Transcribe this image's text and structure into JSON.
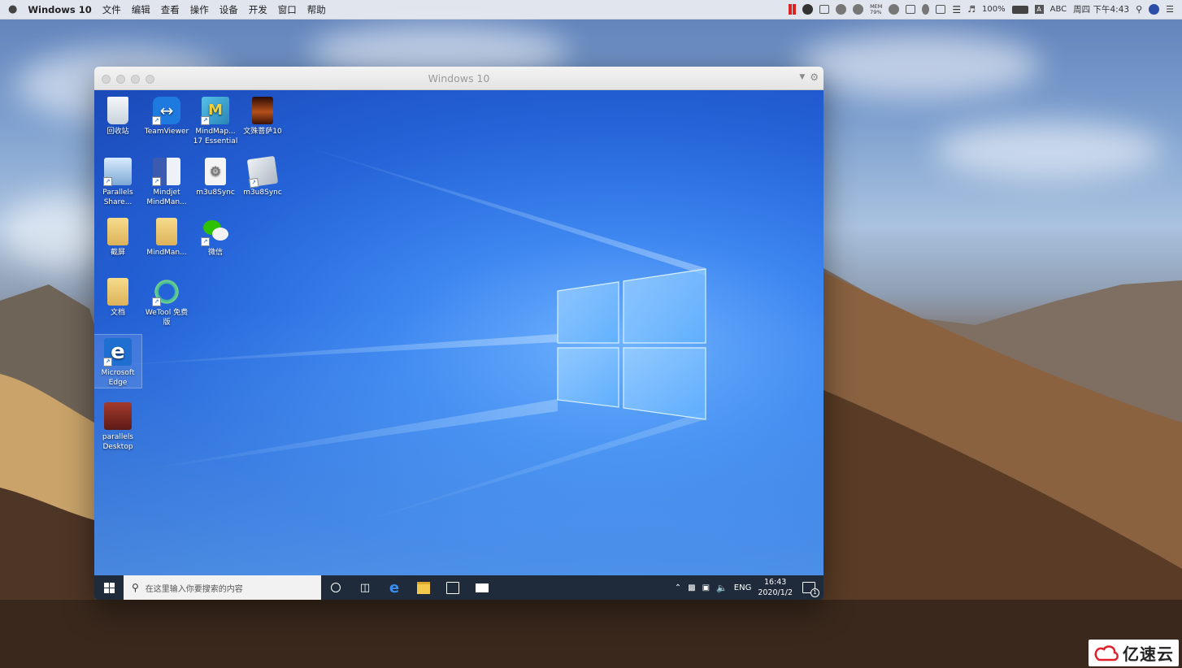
{
  "menubar": {
    "apple": "",
    "app_name": "Windows 10",
    "menus": [
      "文件",
      "编辑",
      "查看",
      "操作",
      "设备",
      "开发",
      "窗口",
      "帮助"
    ],
    "mem_label_top": "MEM",
    "mem_label_bottom": "79%",
    "battery": "100%",
    "input_method": "ABC",
    "clock": "周四 下午4:43"
  },
  "window": {
    "title": "Windows 10"
  },
  "desktop_icons": [
    {
      "label": "回收站",
      "icon": "recycle-bin-icon",
      "color": "#dfe6ee"
    },
    {
      "label": "TeamViewer",
      "icon": "teamviewer-icon",
      "color": "#1f7ae0"
    },
    {
      "label": "MindMap... 17 Essential",
      "icon": "mindmap-icon",
      "color": "#3aa0d8"
    },
    {
      "label": "文殊菩萨10",
      "icon": "manjushri-image-icon",
      "color": "#6a2a10"
    },
    {
      "label": "Parallels Share...",
      "icon": "parallels-share-icon",
      "color": "#8fb4d8"
    },
    {
      "label": "Mindjet MindMan...",
      "icon": "mindjet-icon",
      "color": "#3b5ab0"
    },
    {
      "label": "m3u8Sync",
      "icon": "settings-file-icon",
      "color": "#e8e8e8"
    },
    {
      "label": "m3u8Sync",
      "icon": "m3u8sync-app-icon",
      "color": "#cfd6de"
    },
    {
      "label": "截屏",
      "icon": "folder-icon",
      "color": "#e9c46a"
    },
    {
      "label": "MindMan...",
      "icon": "folder-icon",
      "color": "#e9c46a"
    },
    {
      "label": "微信",
      "icon": "wechat-icon",
      "color": "#2dc100"
    },
    {
      "label": "文档",
      "icon": "folder-icon",
      "color": "#e9c46a"
    },
    {
      "label": "WeTool 免费版",
      "icon": "wetool-icon",
      "color": "#39b5a0"
    },
    {
      "label": "Microsoft Edge",
      "icon": "edge-icon",
      "color": "#1f6fd0"
    },
    {
      "label": "parallels Desktop",
      "icon": "parallels-desktop-icon",
      "color": "#8a2b24"
    }
  ],
  "taskbar": {
    "search_placeholder": "在这里输入你要搜索的内容",
    "lang": "ENG",
    "time": "16:43",
    "date": "2020/1/2",
    "notification_count": "1"
  },
  "watermark": {
    "text": "亿速云"
  },
  "colors": {
    "taskbar": "#1f2a3a",
    "desktop_blue": "#2463d8"
  }
}
